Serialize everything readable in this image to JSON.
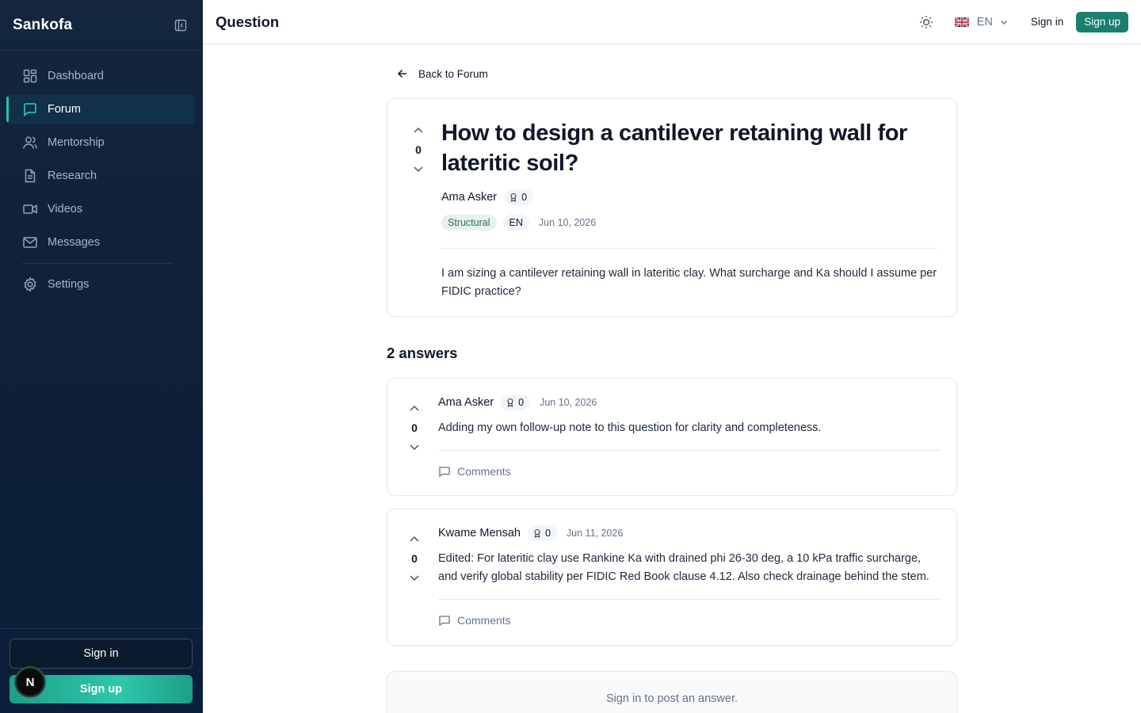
{
  "sidebar": {
    "brand": "Sankofa",
    "nav": [
      {
        "label": "Dashboard",
        "icon": "dashboard-icon"
      },
      {
        "label": "Forum",
        "icon": "message-square-icon",
        "active": true
      },
      {
        "label": "Mentorship",
        "icon": "users-icon"
      },
      {
        "label": "Research",
        "icon": "file-text-icon"
      },
      {
        "label": "Videos",
        "icon": "video-icon"
      },
      {
        "label": "Messages",
        "icon": "mail-icon"
      }
    ],
    "settings": {
      "label": "Settings",
      "icon": "gear-icon"
    },
    "signin_label": "Sign in",
    "signup_label": "Sign up",
    "badge_letter": "N"
  },
  "header": {
    "title": "Question",
    "language": "EN",
    "signin_label": "Sign in",
    "signup_label": "Sign up"
  },
  "question": {
    "back_label": "Back to Forum",
    "title": "How to design a cantilever retaining wall for lateritic soil?",
    "votes": "0",
    "author": "Ama Asker",
    "reputation": "0",
    "tag": "Structural",
    "language": "EN",
    "date": "Jun 10, 2026",
    "body": "I am sizing a cantilever retaining wall in lateritic clay. What surcharge and Ka should I assume per FIDIC practice?"
  },
  "answers_heading": "2 answers",
  "answers": [
    {
      "votes": "0",
      "author": "Ama Asker",
      "reputation": "0",
      "date": "Jun 10, 2026",
      "body": "Adding my own follow-up note to this question for clarity and completeness.",
      "comments_label": "Comments"
    },
    {
      "votes": "0",
      "author": "Kwame Mensah",
      "reputation": "0",
      "date": "Jun 11, 2026",
      "body": "Edited: For lateritic clay use Rankine Ka with drained phi 26-30 deg, a 10 kPa traffic surcharge, and verify global stability per FIDIC Red Book clause 4.12. Also check drainage behind the stem.",
      "comments_label": "Comments"
    }
  ],
  "signin_prompt": "Sign in to post an answer.",
  "colors": {
    "sidebar_bg": "#0f2138",
    "accent": "#22c3a6",
    "signup_button": "#1a7f6e",
    "tag_bg": "#e6f2ef",
    "tag_text": "#2b6d60"
  }
}
